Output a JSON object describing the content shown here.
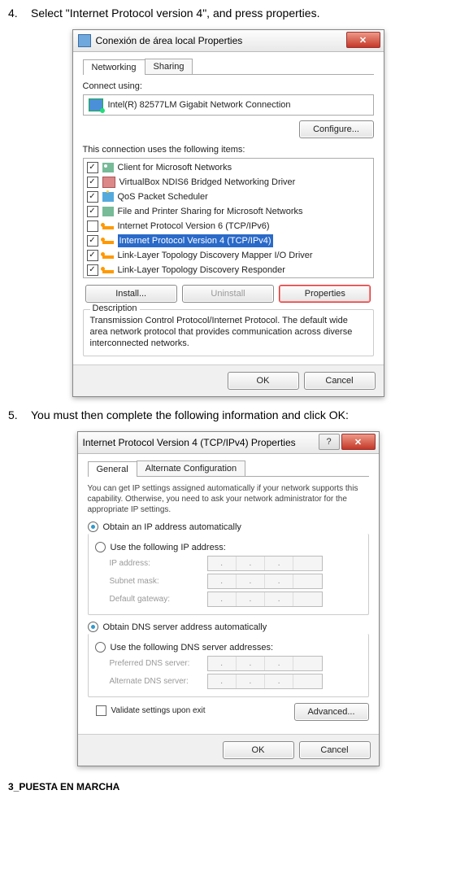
{
  "step4": {
    "num": "4.",
    "text": "Select \"Internet Protocol version 4\", and press properties."
  },
  "step5": {
    "num": "5.",
    "text": "You must then complete the following information and click OK:"
  },
  "d1": {
    "title": "Conexión de área local Properties",
    "tabs": {
      "networking": "Networking",
      "sharing": "Sharing"
    },
    "connect_label": "Connect using:",
    "adapter": "Intel(R) 82577LM Gigabit Network Connection",
    "configure": "Configure...",
    "items_label": "This connection uses the following items:",
    "items": [
      {
        "checked": true,
        "icon": "client",
        "label": "Client for Microsoft Networks"
      },
      {
        "checked": true,
        "icon": "vbox",
        "label": "VirtualBox NDIS6 Bridged Networking Driver"
      },
      {
        "checked": true,
        "icon": "qos",
        "label": "QoS Packet Scheduler"
      },
      {
        "checked": true,
        "icon": "share",
        "label": "File and Printer Sharing for Microsoft Networks"
      },
      {
        "checked": false,
        "icon": "proto",
        "label": "Internet Protocol Version 6 (TCP/IPv6)"
      },
      {
        "checked": true,
        "icon": "proto",
        "label": "Internet Protocol Version 4 (TCP/IPv4)",
        "selected": true
      },
      {
        "checked": true,
        "icon": "proto",
        "label": "Link-Layer Topology Discovery Mapper I/O Driver"
      },
      {
        "checked": true,
        "icon": "proto",
        "label": "Link-Layer Topology Discovery Responder"
      }
    ],
    "install": "Install...",
    "uninstall": "Uninstall",
    "properties": "Properties",
    "desc_label": "Description",
    "desc": "Transmission Control Protocol/Internet Protocol. The default wide area network protocol that provides communication across diverse interconnected networks.",
    "ok": "OK",
    "cancel": "Cancel"
  },
  "d2": {
    "title": "Internet Protocol Version 4 (TCP/IPv4) Properties",
    "tabs": {
      "general": "General",
      "alt": "Alternate Configuration"
    },
    "intro": "You can get IP settings assigned automatically if your network supports this capability. Otherwise, you need to ask your network administrator for the appropriate IP settings.",
    "r1": "Obtain an IP address automatically",
    "r2": "Use the following IP address:",
    "ip": "IP address:",
    "mask": "Subnet mask:",
    "gw": "Default gateway:",
    "r3": "Obtain DNS server address automatically",
    "r4": "Use the following DNS server addresses:",
    "pdns": "Preferred DNS server:",
    "adns": "Alternate DNS server:",
    "validate": "Validate settings upon exit",
    "advanced": "Advanced...",
    "ok": "OK",
    "cancel": "Cancel"
  },
  "footer": "3_PUESTA EN MARCHA"
}
